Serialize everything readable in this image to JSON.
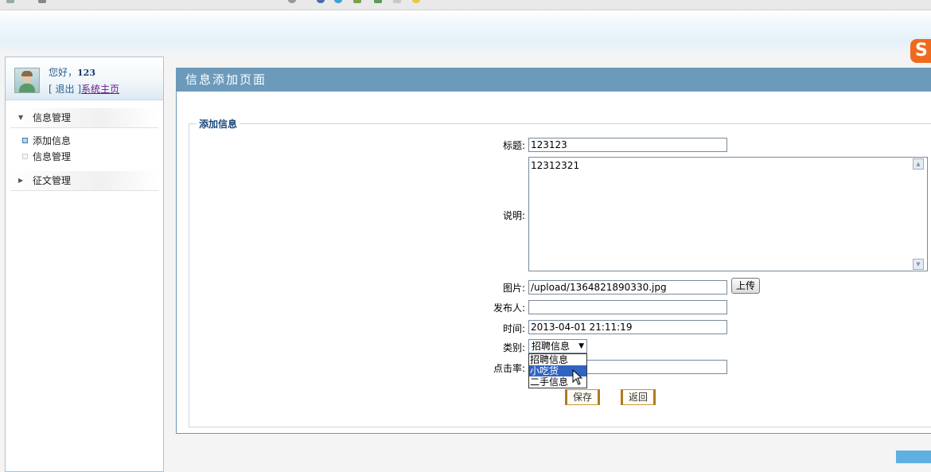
{
  "user": {
    "greeting": "您好，",
    "name": "123",
    "logout_bracket_open": "[ ",
    "logout_label": "退出",
    "logout_bracket_close": " ]",
    "home_link": "系统主页"
  },
  "sidebar": {
    "sections": [
      {
        "label": "信息管理",
        "expanded": true,
        "items": [
          {
            "label": "添加信息",
            "active": true
          },
          {
            "label": "信息管理",
            "active": false
          }
        ]
      },
      {
        "label": "征文管理",
        "expanded": false
      }
    ]
  },
  "main": {
    "title": "信息添加页面",
    "form_legend": "添加信息",
    "fields": {
      "title_label": "标题:",
      "title_value": "123123",
      "desc_label": "说明:",
      "desc_value": "12312321",
      "image_label": "图片:",
      "image_value": "/upload/1364821890330.jpg",
      "upload_button": "上传",
      "publisher_label": "发布人:",
      "publisher_value": "",
      "time_label": "时间:",
      "time_value": "2013-04-01 21:11:19",
      "category_label": "类别:",
      "category_selected": "招聘信息",
      "category_options": [
        "招聘信息",
        "小吃货",
        "二手信息"
      ],
      "category_highlighted": "小吃货",
      "clicks_label": "点击率:",
      "clicks_value": ""
    },
    "save_button": "保存",
    "back_button": "返回"
  },
  "brand": {
    "logo_char": "S",
    "accent": "#6b9abb",
    "logo_color": "#f06a1e"
  }
}
